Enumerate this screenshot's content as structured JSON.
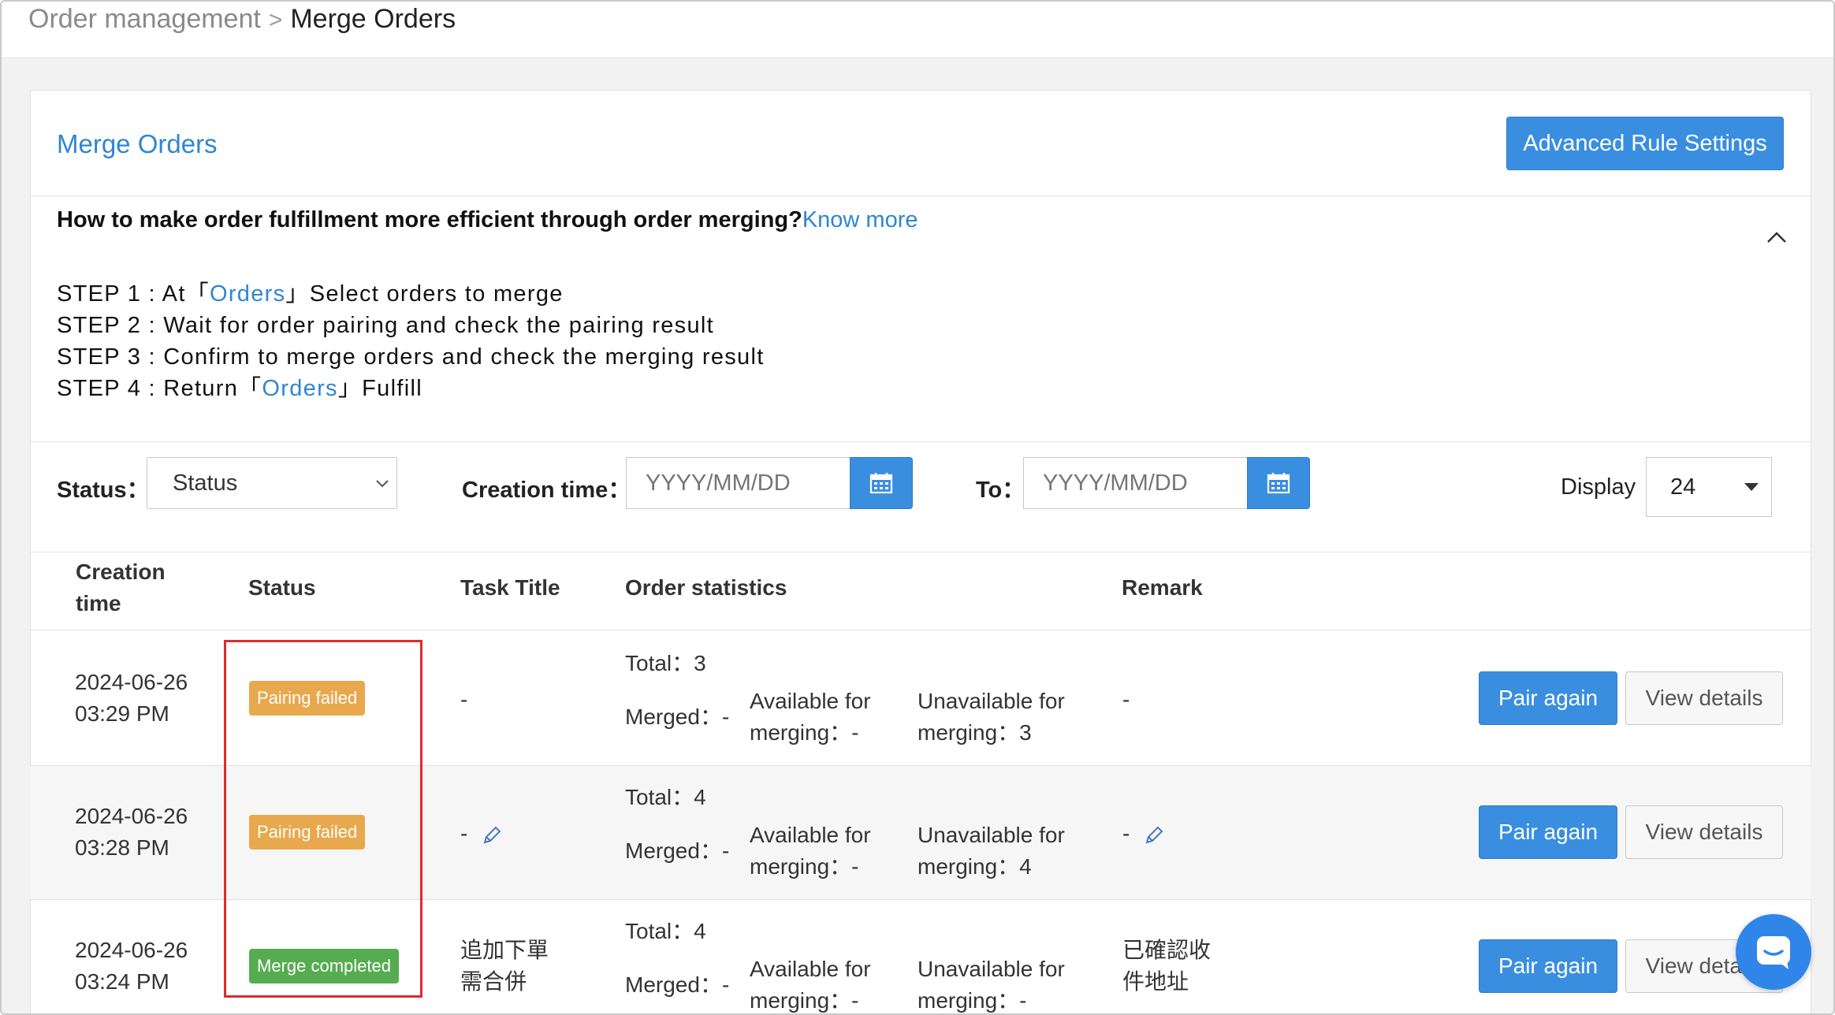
{
  "breadcrumb": {
    "parent": "Order management",
    "separator": ">",
    "current": "Merge Orders"
  },
  "panel": {
    "title": "Merge Orders",
    "advanced_button": "Advanced Rule Settings"
  },
  "info": {
    "question": "How to make order fulfillment more efficient through order merging?",
    "know_more": "Know more",
    "steps": [
      {
        "prefix": "STEP 1 : At「",
        "link": "Orders",
        "suffix": "」Select orders to merge"
      },
      {
        "text": "STEP 2 : Wait for order pairing and check the pairing result"
      },
      {
        "text": "STEP 3 : Confirm to merge orders and check the merging result"
      },
      {
        "prefix": "STEP 4 : Return「",
        "link": "Orders",
        "suffix": "」Fulfill"
      }
    ]
  },
  "filters": {
    "status_label": "Status：",
    "status_value": "Status",
    "creation_label": "Creation time：",
    "date_placeholder": "YYYY/MM/DD",
    "to_label": "To：",
    "display_label": "Display",
    "display_value": "24"
  },
  "table": {
    "headers": {
      "creation_1": "Creation",
      "creation_2": "time",
      "status": "Status",
      "task": "Task Title",
      "stats": "Order statistics",
      "remark": "Remark"
    },
    "rows": [
      {
        "date": "2024-06-26",
        "time": "03:29 PM",
        "status": "Pairing failed",
        "task_1": "-",
        "task_2": "",
        "total": "Total：3",
        "merged": "Merged：-",
        "avail_1": "Available for",
        "avail_2": "merging：-",
        "unavail_1": "Unavailable for",
        "unavail_2": "merging：3",
        "remark_1": "-",
        "remark_2": "",
        "pair": "Pair again",
        "view": "View details"
      },
      {
        "date": "2024-06-26",
        "time": "03:28 PM",
        "status": "Pairing failed",
        "task_1": "-",
        "task_2": "",
        "total": "Total：4",
        "merged": "Merged：-",
        "avail_1": "Available for",
        "avail_2": "merging：-",
        "unavail_1": "Unavailable for",
        "unavail_2": "merging：4",
        "remark_1": "-",
        "remark_2": "",
        "pair": "Pair again",
        "view": "View details"
      },
      {
        "date": "2024-06-26",
        "time": "03:24 PM",
        "status": "Merge completed",
        "task_1": "追加下單",
        "task_2": "需合併",
        "total": "Total：4",
        "merged": "Merged：-",
        "avail_1": "Available for",
        "avail_2": "merging：-",
        "unavail_1": "Unavailable for",
        "unavail_2": "merging：-",
        "remark_1": "已確認收",
        "remark_2": "件地址",
        "pair": "Pair again",
        "view": "View details"
      }
    ]
  },
  "colors": {
    "accent": "#3a8ee0",
    "link": "#2f86d1",
    "warning": "#e8a84d",
    "success": "#56ac50",
    "highlight": "#e02b2b"
  }
}
